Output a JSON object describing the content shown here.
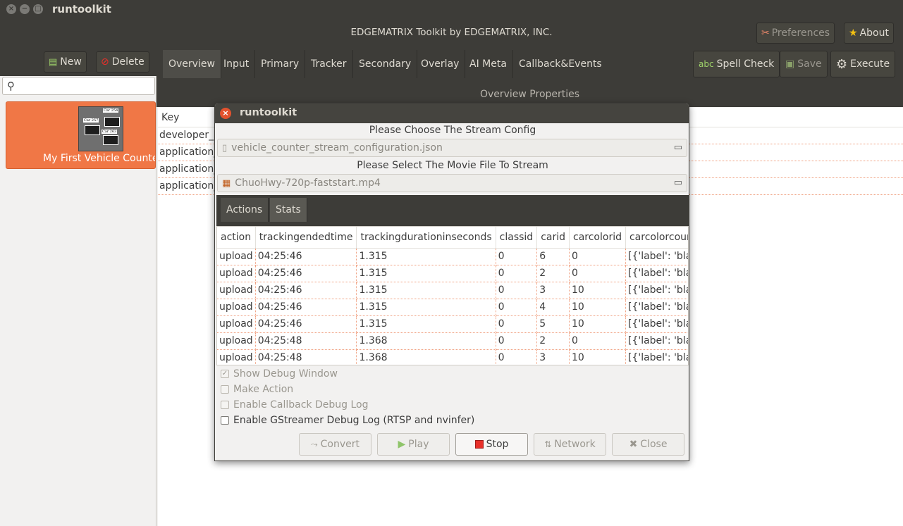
{
  "window": {
    "title": "runtoolkit",
    "controls": [
      "close",
      "minimize",
      "maximize"
    ]
  },
  "header": {
    "app_title": "EDGEMATRIX Toolkit by EDGEMATRIX, INC.",
    "preferences_label": "Preferences",
    "about_label": "About"
  },
  "sidebar": {
    "new_label": "New",
    "delete_label": "Delete",
    "search_placeholder": "",
    "project": {
      "name": "My First Vehicle Counter",
      "thumb_tags": [
        "Car 254",
        "Car 257",
        "Car 263"
      ]
    }
  },
  "tabs": [
    "Overview",
    "Input",
    "Primary",
    "Tracker",
    "Secondary",
    "Overlay",
    "AI Meta",
    "Callback&Events"
  ],
  "active_tab": "Overview",
  "toolbar": {
    "spell_check_label": "Spell Check",
    "save_label": "Save",
    "execute_label": "Execute"
  },
  "overview": {
    "section_title": "Overview Properties",
    "key_header": "Key",
    "rows": [
      "developer_",
      "application_",
      "application_",
      "application_"
    ]
  },
  "dialog": {
    "title": "runtoolkit",
    "stream_config_label": "Please Choose The Stream Config",
    "stream_config_file": "vehicle_counter_stream_configuration.json",
    "movie_label": "Please Select The Movie File To Stream",
    "movie_file": "ChuoHwy-720p-faststart.mp4",
    "tabs": [
      "Actions",
      "Stats"
    ],
    "columns": [
      "action",
      "trackingendedtime",
      "trackingdurationinseconds",
      "classid",
      "carid",
      "carcolorid",
      "carcolorcour"
    ],
    "rows": [
      [
        "upload",
        "04:25:46",
        "1.315",
        "0",
        "6",
        "0",
        "[{'label': 'blac"
      ],
      [
        "upload",
        "04:25:46",
        "1.315",
        "0",
        "2",
        "0",
        "[{'label': 'blac"
      ],
      [
        "upload",
        "04:25:46",
        "1.315",
        "0",
        "3",
        "10",
        "[{'label': 'blac"
      ],
      [
        "upload",
        "04:25:46",
        "1.315",
        "0",
        "4",
        "10",
        "[{'label': 'blac"
      ],
      [
        "upload",
        "04:25:46",
        "1.315",
        "0",
        "5",
        "10",
        "[{'label': 'blac"
      ],
      [
        "upload",
        "04:25:48",
        "1.368",
        "0",
        "2",
        "0",
        "[{'label': 'blac"
      ],
      [
        "upload",
        "04:25:48",
        "1.368",
        "0",
        "3",
        "10",
        "[{'label': 'blac"
      ]
    ],
    "options": {
      "show_debug_window": {
        "label": "Show Debug Window",
        "checked": true,
        "enabled": false
      },
      "make_action": {
        "label": "Make Action",
        "checked": false,
        "enabled": false
      },
      "callback_debug": {
        "label": "Enable Callback Debug Log",
        "checked": false,
        "enabled": false
      },
      "gstreamer_debug": {
        "label": "Enable GStreamer Debug Log (RTSP and nvinfer)",
        "checked": false,
        "enabled": true
      }
    },
    "buttons": {
      "convert": "Convert",
      "play": "Play",
      "stop": "Stop",
      "network": "Network",
      "close": "Close"
    }
  }
}
